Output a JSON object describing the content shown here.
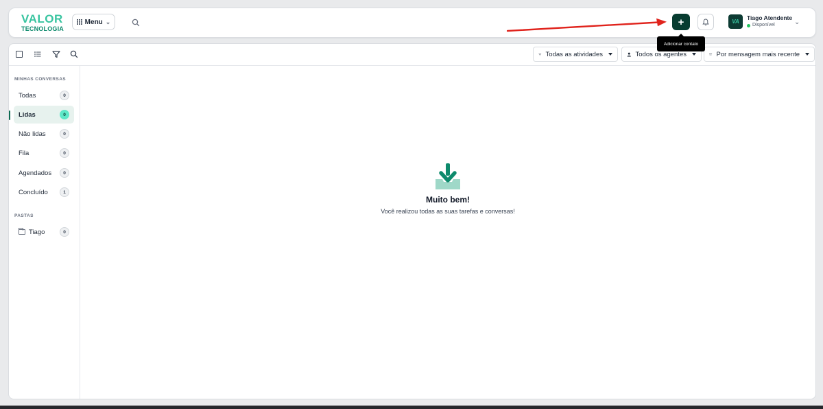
{
  "header": {
    "logo_top": "VALOR",
    "logo_bottom": "TECNOLOGIA",
    "menu_label": "Menu",
    "add_button_label": "+",
    "tooltip": "Adicionar contato",
    "user": {
      "initials": "VA",
      "name": "Tiago Atendente",
      "status": "Disponível"
    }
  },
  "toolbar": {
    "filters": [
      {
        "label": "Todas as atividades"
      },
      {
        "label": "Todos os agentes"
      },
      {
        "label": "Por mensagem mais recente"
      }
    ]
  },
  "sidebar": {
    "section1_title": "MINHAS CONVERSAS",
    "items": [
      {
        "label": "Todas",
        "count": "0"
      },
      {
        "label": "Lidas",
        "count": "0"
      },
      {
        "label": "Não lidas",
        "count": "0"
      },
      {
        "label": "Fila",
        "count": "0"
      },
      {
        "label": "Agendados",
        "count": "0"
      },
      {
        "label": "Concluído",
        "count": "1"
      }
    ],
    "section2_title": "PASTAS",
    "folders": [
      {
        "label": "Tiago",
        "count": "0"
      }
    ]
  },
  "empty_state": {
    "title": "Muito bem!",
    "subtitle": "Você realizou todas as suas tarefas e conversas!"
  },
  "colors": {
    "brand_dark": "#073c30",
    "brand_accent": "#38c4a0",
    "active_badge": "#5ee8c8",
    "arrow": "#e0231c"
  }
}
